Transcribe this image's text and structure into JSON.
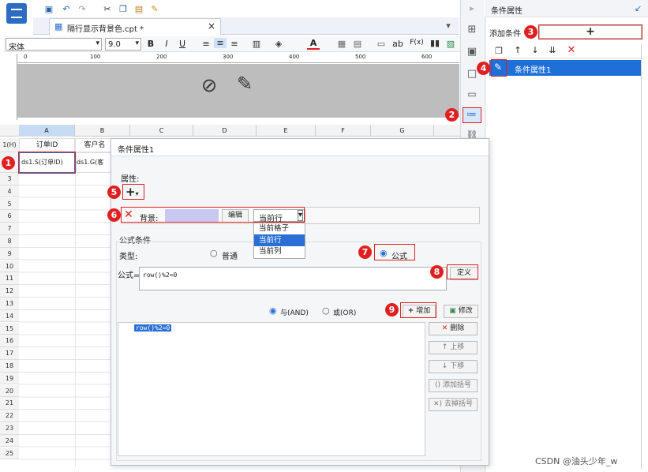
{
  "toolbar": {
    "font_name": "宋体",
    "font_size": "9.0",
    "bold": "B",
    "italic": "I",
    "underline": "U",
    "color_a": "A",
    "label_ab": "ab",
    "label_fx": "F(x)"
  },
  "tab": {
    "title": "隔行显示背景色.cpt *",
    "close": "×"
  },
  "ruler": {
    "ticks": [
      "0",
      "100",
      "200",
      "300",
      "400",
      "500",
      "600"
    ]
  },
  "columns": [
    "A",
    "B",
    "C",
    "D",
    "E",
    "F",
    "G"
  ],
  "grid": {
    "header_row": "1(H)",
    "header_cells": [
      "订单ID",
      "客户名"
    ],
    "data_row": "2",
    "cell_a": "ds1.S(订单ID)",
    "cell_b": "ds1.G(客",
    "rows": [
      "3",
      "4",
      "5",
      "6",
      "7",
      "8",
      "9",
      "10",
      "11",
      "12",
      "13",
      "14",
      "15",
      "16",
      "17",
      "18",
      "19",
      "20",
      "21",
      "22",
      "23",
      "24",
      "25"
    ]
  },
  "right_panel": {
    "title": "条件属性",
    "add_label": "添加条件",
    "add_btn": "+",
    "item": "条件属性1"
  },
  "dialog": {
    "title": "条件属性1",
    "attr_label": "属性:",
    "add_attr": "+",
    "bg_label": "背景:",
    "edit_btn": "编辑",
    "scope_value": "当前行",
    "dropdown": [
      "当前格子",
      "当前行",
      "当前列"
    ],
    "formula_cond": "公式条件",
    "type_label": "类型:",
    "radio_normal": "普通",
    "radio_formula": "公式",
    "formula_label": "公式=",
    "formula_value": "row()%2=0",
    "define_btn": "定义",
    "and_label": "与(AND)",
    "or_label": "或(OR)",
    "add_btn": "增加",
    "modify_btn": "修改",
    "list_item": "row()%2=0",
    "delete_btn": "删除",
    "up_btn": "上移",
    "down_btn": "下移",
    "add_bracket": "添加括号",
    "remove_bracket": "去掉括号"
  },
  "badges": [
    "1",
    "2",
    "3",
    "4",
    "5",
    "6",
    "7",
    "8",
    "9"
  ],
  "footer": "CSDN @油头少年_w",
  "colors": {
    "accent": "#2a6fd6",
    "red": "#e02020",
    "selection": "#1f6fd9"
  }
}
